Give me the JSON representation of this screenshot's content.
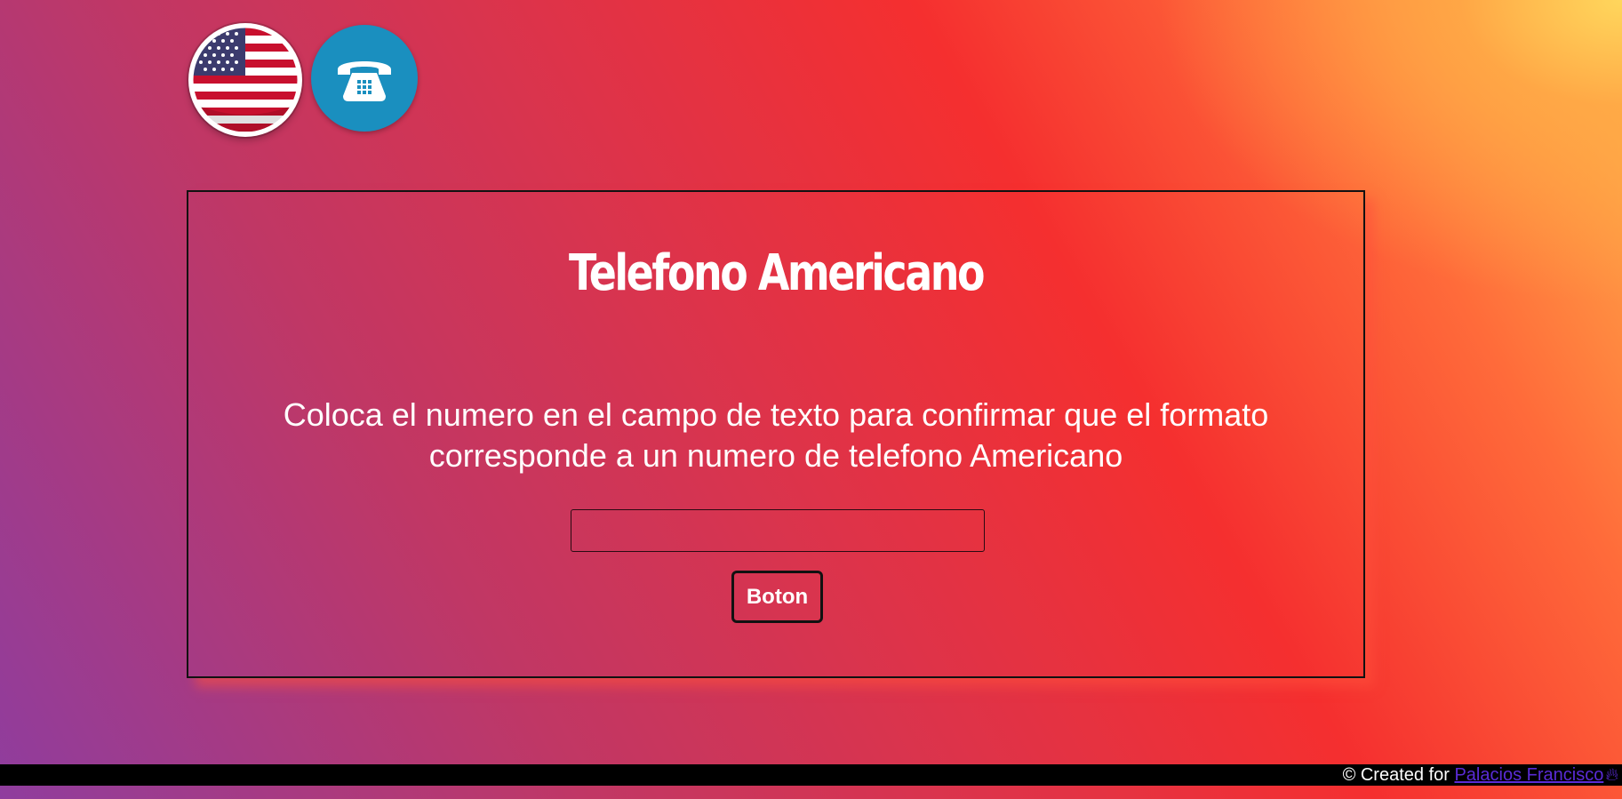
{
  "header": {
    "flag_icon": "us-flag-icon",
    "phone_icon": "telephone-icon",
    "phone_logo_color": "#1a8fbf"
  },
  "main": {
    "title": "Telefono Americano",
    "instructions": "Coloca el numero en el campo de texto para confirmar que el formato corresponde a un numero de telefono Americano",
    "phone_input": {
      "value": "",
      "placeholder": ""
    },
    "button_label": "Boton"
  },
  "footer": {
    "prefix": "© Created for",
    "author_link": "Palacios Francisco",
    "flame_icon": "flame-icon"
  },
  "colors": {
    "background_start": "#8f3d9e",
    "background_mid": "#f52f2f",
    "background_end": "#ffd65c",
    "text": "#ffffff",
    "link": "#5a2bd6",
    "footer_bg": "#000000"
  }
}
